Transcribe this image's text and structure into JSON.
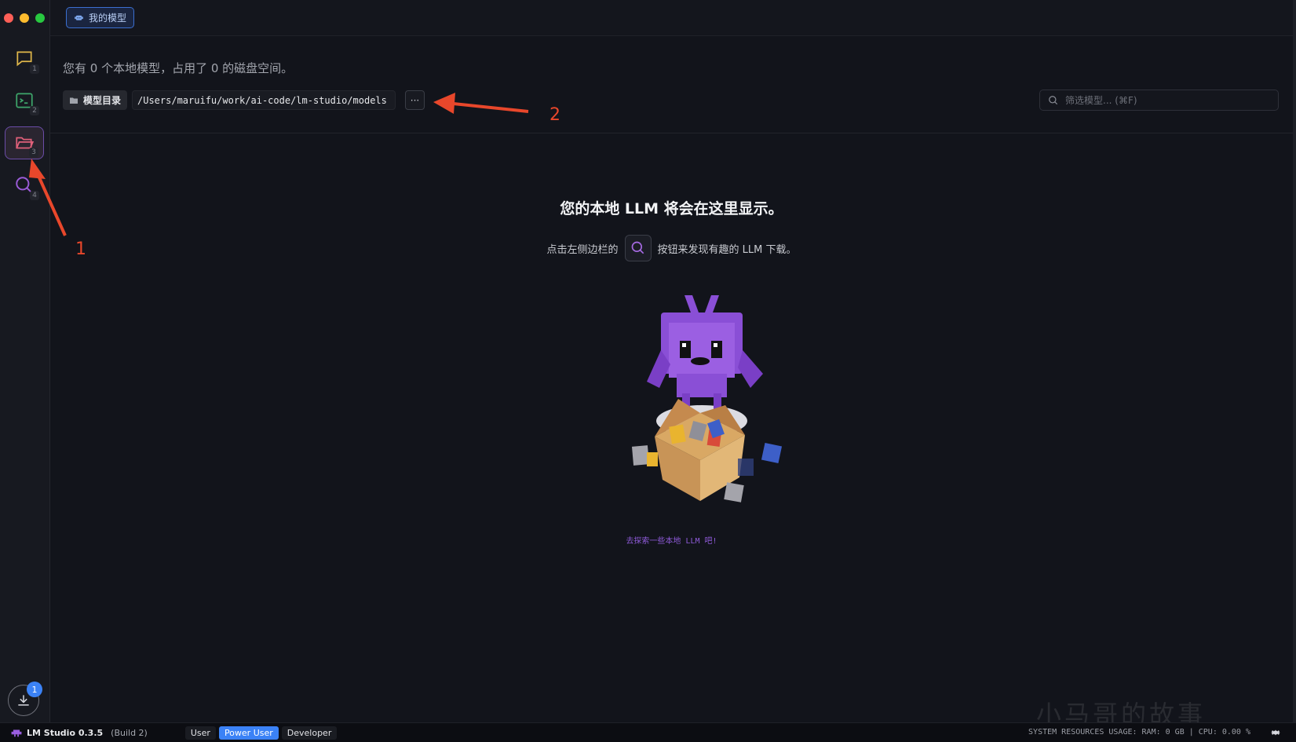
{
  "window": {
    "traffic_lights": [
      "close",
      "minimize",
      "zoom"
    ]
  },
  "sidebar": {
    "items": [
      {
        "name": "chat",
        "icon": "chat-bubble-icon",
        "num": "1",
        "color": "#e0b74a"
      },
      {
        "name": "developer",
        "icon": "terminal-icon",
        "num": "2",
        "color": "#3ea66b"
      },
      {
        "name": "my-models",
        "icon": "folder-icon",
        "num": "3",
        "color": "#e0607a",
        "active": true
      },
      {
        "name": "discover",
        "icon": "search-icon",
        "num": "4",
        "color": "#9b5bd8"
      }
    ],
    "downloads_badge": "1"
  },
  "topbar": {
    "tab_label": "我的模型"
  },
  "main": {
    "summary": "您有 0 个本地模型，占用了 0 的磁盘空间。",
    "dir_label": "模型目录",
    "dir_path": "/Users/maruifu/work/ai-code/lm-studio/models",
    "more_label": "···",
    "search_placeholder": "筛选模型... (⌘F)",
    "empty_title": "您的本地 LLM 将会在这里显示。",
    "hint_before": "点击左侧边栏的",
    "hint_after": "按钮来发现有趣的 LLM 下载。",
    "explore_link": "去探索一些本地 LLM 吧!"
  },
  "annotations": {
    "label_1": "1",
    "label_2": "2",
    "color": "#e8472b"
  },
  "watermark": "小马哥的故事",
  "statusbar": {
    "app_name": "LM Studio 0.3.5",
    "build": "(Build 2)",
    "modes": [
      "User",
      "Power User",
      "Developer"
    ],
    "active_mode": "Power User",
    "sys_usage": "SYSTEM RESOURCES USAGE:  RAM: 0 GB | CPU: 0.00 %"
  },
  "colors": {
    "accent_blue": "#3b82f6",
    "active_border": "#6b4ca8",
    "mascot_purple": "#8a4fd6"
  }
}
